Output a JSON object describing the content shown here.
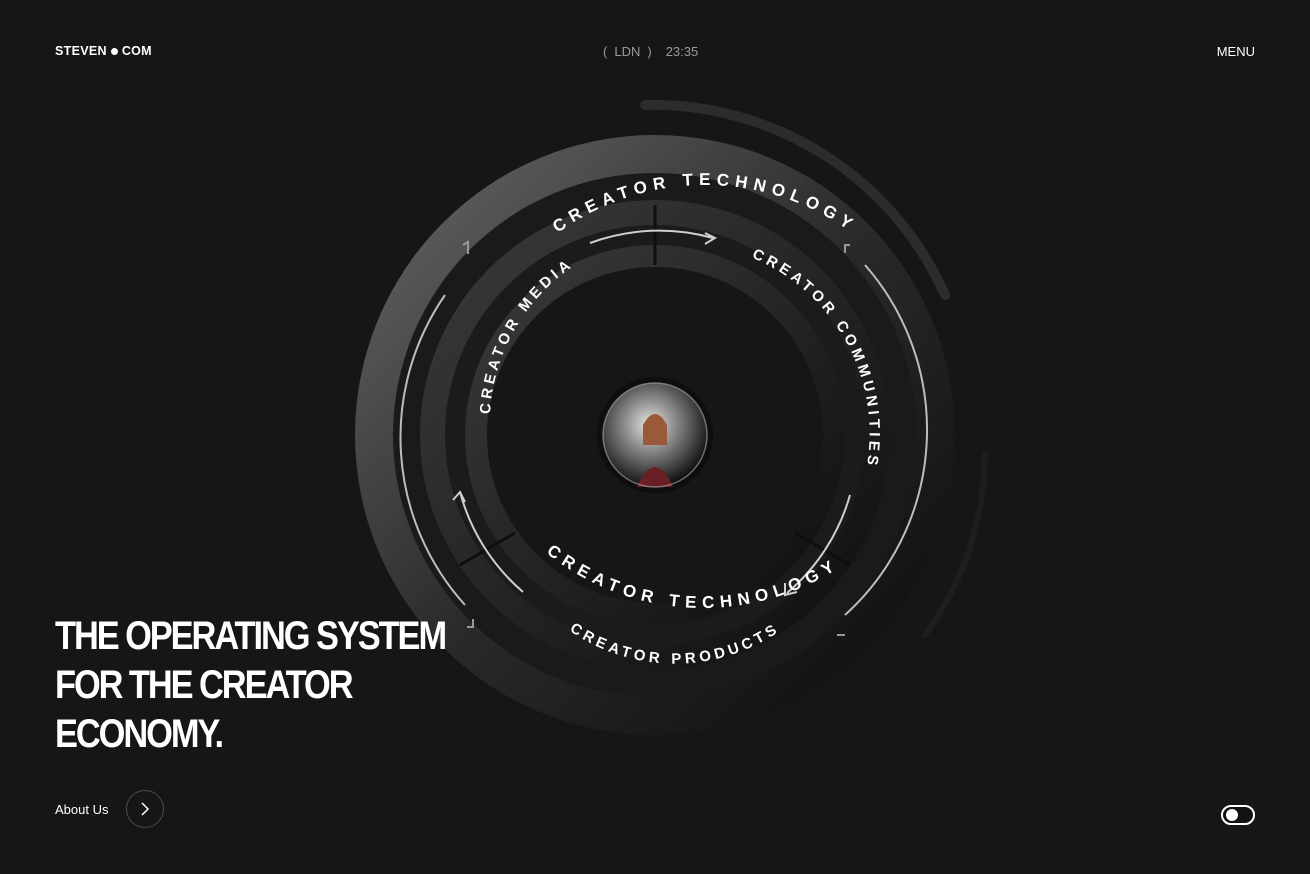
{
  "header": {
    "logo_left": "STEVEN",
    "logo_right": "COM",
    "locale_open": "(",
    "locale_city": "LDN",
    "locale_close": ")",
    "time": "23:35",
    "menu_label": "MENU"
  },
  "hero": {
    "headline_lines": [
      "THE OPERATING SYSTEM",
      "FOR THE CREATOR",
      "ECONOMY."
    ]
  },
  "diagram": {
    "outer_top_label": "CREATOR TECHNOLOGY",
    "outer_bottom_label": "CREATOR TECHNOLOGY",
    "segment_left_label": "CREATOR MEDIA",
    "segment_right_label": "CREATOR COMMUNITIES",
    "segment_bottom_label": "CREATOR PRODUCTS"
  },
  "footer": {
    "about_label": "About Us",
    "theme_toggle_on": false
  },
  "colors": {
    "background": "#161616",
    "ring_highlight": "#8a8a8a",
    "text": "#ffffff",
    "muted": "#9a9a9a"
  },
  "icons": {
    "about_arrow": "chevron-right-icon",
    "center": "portrait-lens"
  }
}
